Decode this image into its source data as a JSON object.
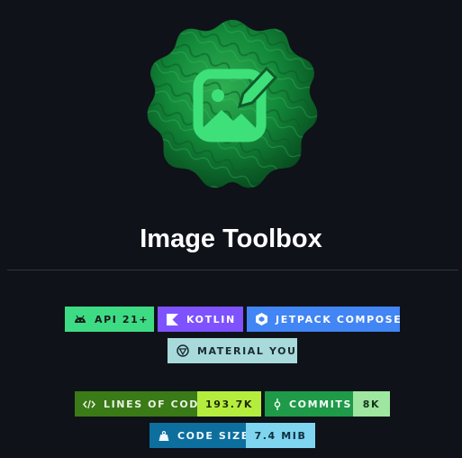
{
  "title": "Image Toolbox",
  "logo": {
    "icon": "image-edit-icon",
    "background": "green-malachite-badge"
  },
  "tech_badges": {
    "api": {
      "icon": "android-icon",
      "label": "API 21+"
    },
    "kotlin": {
      "icon": "kotlin-icon",
      "label": "KOTLIN"
    },
    "compose": {
      "icon": "jetpack-compose-icon",
      "label": "JETPACK COMPOSE"
    },
    "material": {
      "icon": "material-you-icon",
      "label": "MATERIAL YOU"
    }
  },
  "stats": {
    "lines_of_code": {
      "icon": "code-icon",
      "label": "LINES OF CODE",
      "value": "193.7K"
    },
    "commits": {
      "icon": "git-commit-icon",
      "label": "COMMITS",
      "value": "8K"
    },
    "code_size": {
      "icon": "weight-icon",
      "label": "CODE SIZE",
      "value": "7.4 MIB"
    }
  },
  "colors": {
    "background": "#0f1219",
    "api": "#3ddc84",
    "kotlin": "#7f52ff",
    "compose": "#4285f4",
    "material": "#a8dadc",
    "loc_label": "#3a7a17",
    "loc_value": "#b5ed3e",
    "commits_label": "#1f9a48",
    "commits_value": "#9fe6a0",
    "size_label": "#0d6f9e",
    "size_value": "#7fd4f0"
  }
}
